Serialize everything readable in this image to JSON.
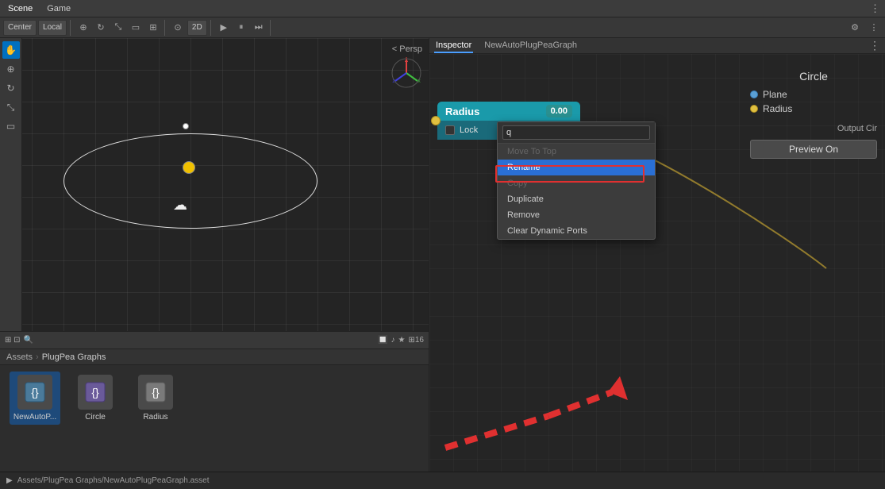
{
  "topbar": {
    "scene_label": "Scene",
    "game_label": "Game",
    "more_icon": "⋮"
  },
  "toolbar": {
    "center_label": "Center",
    "local_label": "Local",
    "transform_icon": "⊞",
    "mode_2d": "2D",
    "play_icon": "▶",
    "pause_icon": "⏸",
    "step_icon": "⏭",
    "settings_icon": "⚙"
  },
  "scene": {
    "persp_label": "< Persp"
  },
  "assets": {
    "breadcrumb": [
      "Assets",
      "PlugPea Graphs"
    ],
    "items": [
      {
        "name": "NewAutoP...",
        "type": "script"
      },
      {
        "name": "Circle",
        "type": "graph"
      },
      {
        "name": "Radius",
        "type": "graph"
      }
    ]
  },
  "inspector": {
    "tab_label": "Inspector",
    "graph_tab_label": "NewAutoPlugPeaGraph"
  },
  "circle_node": {
    "title": "Circle",
    "ports": [
      {
        "label": "Plane",
        "color": "blue"
      },
      {
        "label": "Radius",
        "color": "yellow"
      }
    ],
    "output_label": "Output Cir",
    "preview_btn": "Preview On"
  },
  "radius_node": {
    "title": "Radius",
    "value": "0.00",
    "lock_label": "Lock"
  },
  "context_menu": {
    "search_placeholder": "q",
    "items": [
      {
        "label": "Move To Top",
        "state": "disabled"
      },
      {
        "label": "Rename",
        "state": "highlighted"
      },
      {
        "label": "Copy",
        "state": "disabled"
      },
      {
        "label": "Duplicate",
        "state": "normal"
      },
      {
        "label": "Remove",
        "state": "normal"
      },
      {
        "label": "Clear Dynamic Ports",
        "state": "normal"
      }
    ]
  },
  "statusbar": {
    "path": "Assets/PlugPea Graphs/NewAutoPlugPeaGraph.asset"
  },
  "scene_tools": [
    "✋",
    "⟲",
    "⟳",
    "⤢",
    "⬜"
  ],
  "icons": {
    "more": "⋮",
    "lock": "🔒",
    "arrow_left": "←",
    "checkbox": "□"
  }
}
